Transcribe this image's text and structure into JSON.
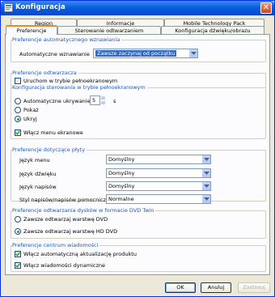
{
  "window": {
    "title": "Konfiguracja"
  },
  "tabs_row1": [
    {
      "label": "Region"
    },
    {
      "label": "Informacje"
    },
    {
      "label": "Mobile Technology Pack"
    }
  ],
  "tabs_row2": [
    {
      "label": "Preferencje"
    },
    {
      "label": "Sterowanie odtwarzaniem"
    },
    {
      "label": "Konfiguracja dźwięku/obrazu"
    }
  ],
  "resume": {
    "title": "Preferencje automatycznego wznawiania",
    "label": "Automatyczne wznawianie",
    "value": "Zawsze zaczynaj od początku"
  },
  "player": {
    "title": "Preferencje odtwarzacza",
    "fullscreen_label": "Uruchom w trybie pełnoekranowym",
    "fullscreen_checked": false,
    "config_title": "Konfiguracja sterowania w trybie pełnoekranowym",
    "auto_hide_label": "Automatyczne ukrywanie",
    "auto_hide_value": "5",
    "auto_hide_unit": "s",
    "show_label": "Pokaż",
    "hide_label": "Ukryj",
    "selected_mode": "hide",
    "menu_label": "Włącz menu ekranowe",
    "menu_checked": true
  },
  "disc": {
    "title": "Preferencje dotyczące płyty",
    "rows": [
      {
        "label": "Język menu",
        "value": "Domyślny"
      },
      {
        "label": "Język dźwięku",
        "value": "Domyślny"
      },
      {
        "label": "Język napisów",
        "value": "Domyślny"
      },
      {
        "label": "Styl napisów/napisów pomocniczych",
        "value": "Normalne"
      }
    ]
  },
  "dvd_twin": {
    "title": "Preferencje odtwarzania dysków w formacie DVD Twin",
    "option_dvd": "Zawsze odtwarzaj warstwę DVD",
    "option_hddvd": "Zawsze odtwarzaj warstwę HD DVD",
    "selected": "hddvd"
  },
  "messages": {
    "title": "Preferencje centrum wiadomości",
    "auto_update_label": "Włącz automatyczną aktualizację produktu",
    "auto_update_checked": true,
    "dynamic_label": "Włącz wiadomości dynamiczne",
    "dynamic_checked": true
  },
  "buttons": {
    "ok": "OK",
    "cancel": "Anuluj",
    "apply": "Zastosuj"
  }
}
